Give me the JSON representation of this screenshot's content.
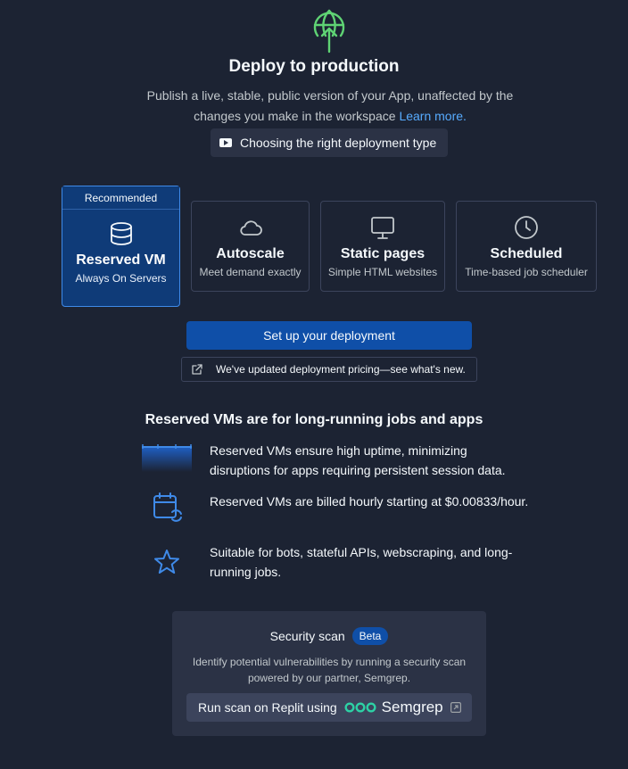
{
  "header": {
    "title": "Deploy to production",
    "description": "Publish a live, stable, public version of your App, unaffected by the changes you make in the workspace",
    "learn_more": "Learn more.",
    "video_button": "Choosing the right deployment type"
  },
  "deployment_types": {
    "recommended_label": "Recommended",
    "reserved_vm": {
      "name": "Reserved VM",
      "subtitle": "Always On Servers",
      "icon": "database-icon",
      "selected": true
    },
    "autoscale": {
      "name": "Autoscale",
      "subtitle": "Meet demand exactly",
      "icon": "cloud-icon"
    },
    "static_pages": {
      "name": "Static pages",
      "subtitle": "Simple HTML websites",
      "icon": "monitor-icon"
    },
    "scheduled": {
      "name": "Scheduled",
      "subtitle": "Time-based job scheduler",
      "icon": "clock-icon"
    }
  },
  "actions": {
    "setup_button": "Set up your deployment",
    "pricing_notice": "We've updated deployment pricing—see what's new."
  },
  "features": {
    "title": "Reserved VMs are for long-running jobs and apps",
    "items": [
      {
        "text": "Reserved VMs ensure high uptime, minimizing disruptions for apps requiring persistent session data.",
        "icon": "uptime-graphic"
      },
      {
        "text": "Reserved VMs are billed hourly starting at $0.00833/hour.",
        "icon": "calendar-refresh-icon"
      },
      {
        "text": "Suitable for bots, stateful APIs, webscraping, and long-running jobs.",
        "icon": "star-icon"
      }
    ]
  },
  "security_scan": {
    "title": "Security scan",
    "badge": "Beta",
    "description": "Identify potential vulnerabilities by running a security scan powered by our partner, Semgrep.",
    "button_label": "Run scan on Replit using",
    "partner_name": "Semgrep"
  },
  "colors": {
    "background": "#1c2333",
    "panel": "#2b3245",
    "accent_blue": "#0f4fa8",
    "selected_card": "#0f3b78",
    "link": "#57abff",
    "deploy_icon": "#5fd374",
    "semgrep_green": "#2dd1a5"
  }
}
